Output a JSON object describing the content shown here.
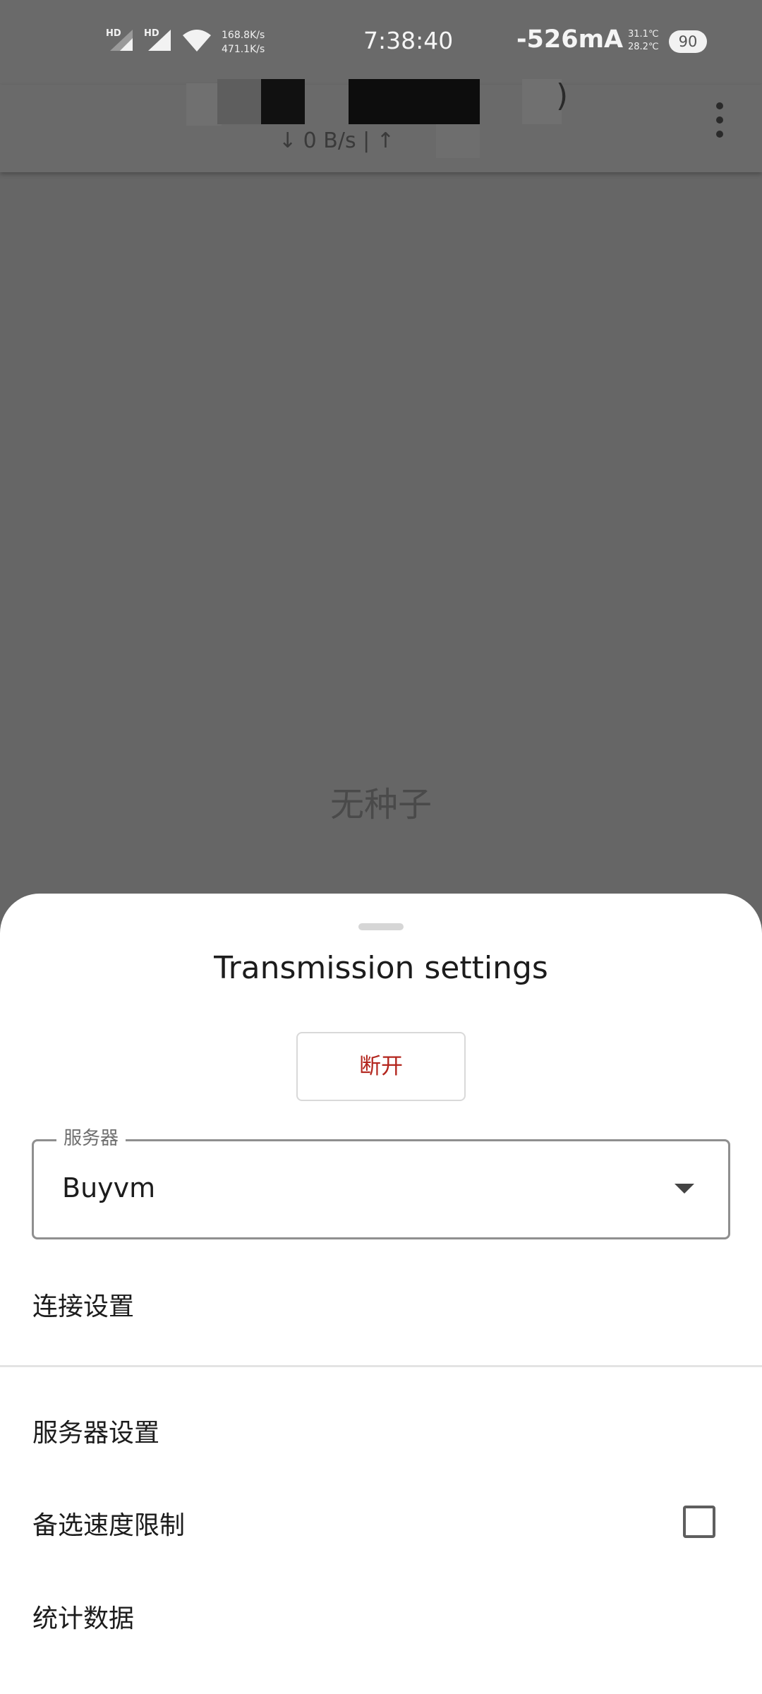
{
  "status_bar": {
    "signal1_label": "HD",
    "signal2_label": "HD",
    "net_speed_down": "168.8K/s",
    "net_speed_up": "471.1K/s",
    "time": "7:38:40",
    "current": "-526mA",
    "temp_top": "31.1℃",
    "temp_bottom": "28.2℃",
    "battery": "90"
  },
  "app_bar": {
    "title_fragment": ")",
    "subtitle": "↓ 0 B/s  |  ↑"
  },
  "main": {
    "empty_text": "无种子"
  },
  "sheet": {
    "title": "Transmission settings",
    "disconnect_label": "断开",
    "server_label": "服务器",
    "server_value": "Buyvm",
    "connection_settings": "连接设置",
    "server_settings": "服务器设置",
    "alt_speed_limit": "备选速度限制",
    "alt_speed_checked": false,
    "statistics": "统计数据"
  },
  "colors": {
    "scrim": "#666666",
    "accent_red": "#b3261e",
    "sheet_bg": "#ffffff"
  }
}
